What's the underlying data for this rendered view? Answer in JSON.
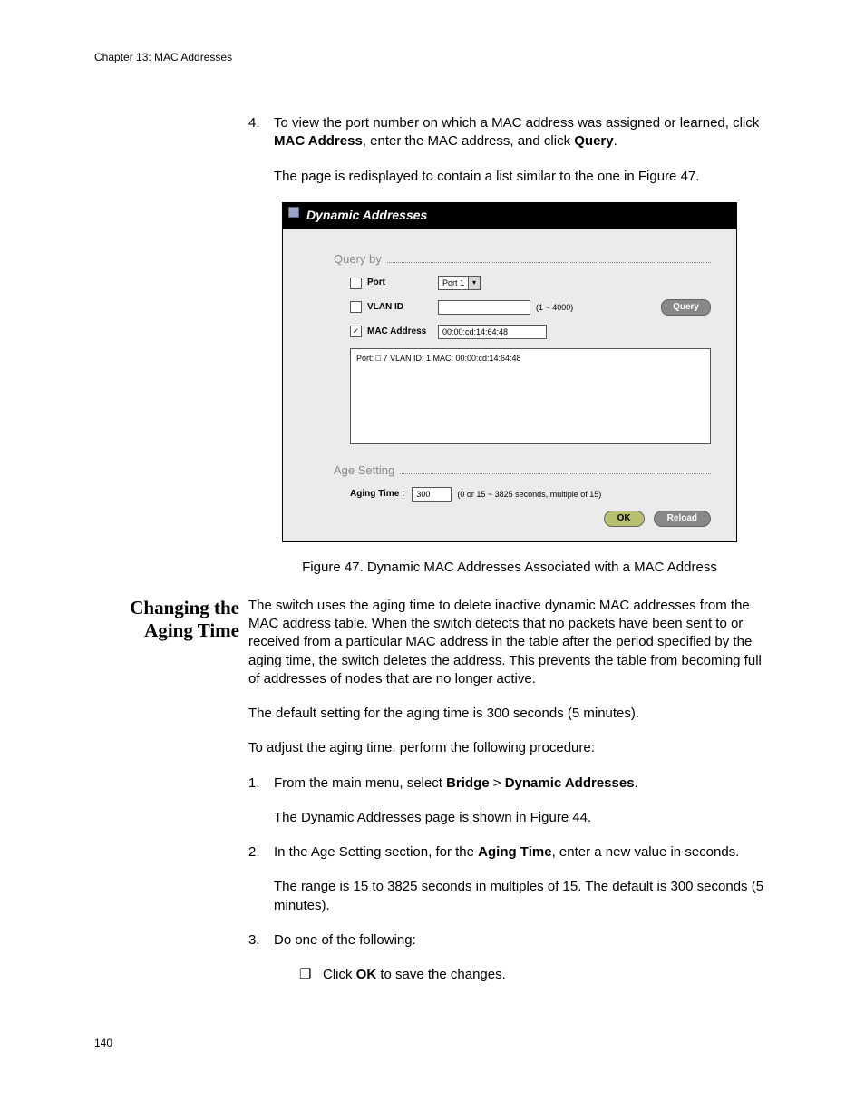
{
  "header": "Chapter 13: MAC Addresses",
  "page_number": "140",
  "intro_step": {
    "marker": "4.",
    "para1_a": "To view the port number on which a MAC address was assigned or learned, click ",
    "para1_b": "MAC Address",
    "para1_c": ", enter the MAC address, and click ",
    "para1_d": "Query",
    "para1_e": ".",
    "para2": "The page is redisplayed to contain a list similar to the one in Figure 47."
  },
  "figure": {
    "caption": "Figure 47. Dynamic MAC Addresses Associated with a MAC Address",
    "title": "Dynamic Addresses",
    "query_label": "Query by",
    "rows": {
      "port": {
        "label": "Port",
        "value": "Port 1"
      },
      "vlan": {
        "label": "VLAN ID",
        "range": "(1 ~ 4000)"
      },
      "mac": {
        "label": "MAC Address",
        "value": "00:00:cd:14:64:48"
      }
    },
    "query_button": "Query",
    "result_line": "Port: □  7  VLAN ID:     1  MAC: 00:00:cd:14:64:48",
    "age_label": "Age Setting",
    "aging_time_label": "Aging Time :",
    "aging_time_value": "300",
    "aging_hint": "(0 or 15 ~ 3825 seconds, multiple of 15)",
    "ok": "OK",
    "reload": "Reload"
  },
  "section_heading": "Changing the Aging Time",
  "body": {
    "p1": "The switch uses the aging time to delete inactive dynamic MAC addresses from the MAC address table. When the switch detects that no packets have been sent to or received from a particular MAC address in the table after the period specified by the aging time, the switch deletes the address. This prevents the table from becoming full of addresses of nodes that are no longer active.",
    "p2": "The default setting for the aging time is 300 seconds (5 minutes).",
    "p3": "To adjust the aging time, perform the following procedure:"
  },
  "steps": {
    "s1": {
      "marker": "1.",
      "a": "From the main menu, select ",
      "b": "Bridge",
      "c": " > ",
      "d": "Dynamic Addresses",
      "e": ".",
      "followup": "The Dynamic Addresses page is shown in Figure 44."
    },
    "s2": {
      "marker": "2.",
      "a": "In the Age Setting section, for the ",
      "b": "Aging Time",
      "c": ", enter a new value in seconds.",
      "followup": "The range is 15 to 3825 seconds in multiples of 15. The default is 300 seconds (5 minutes)."
    },
    "s3": {
      "marker": "3.",
      "text": "Do one of the following:",
      "bullet_glyph": "❐",
      "bullet_a": "Click ",
      "bullet_b": "OK",
      "bullet_c": " to save the changes."
    }
  }
}
